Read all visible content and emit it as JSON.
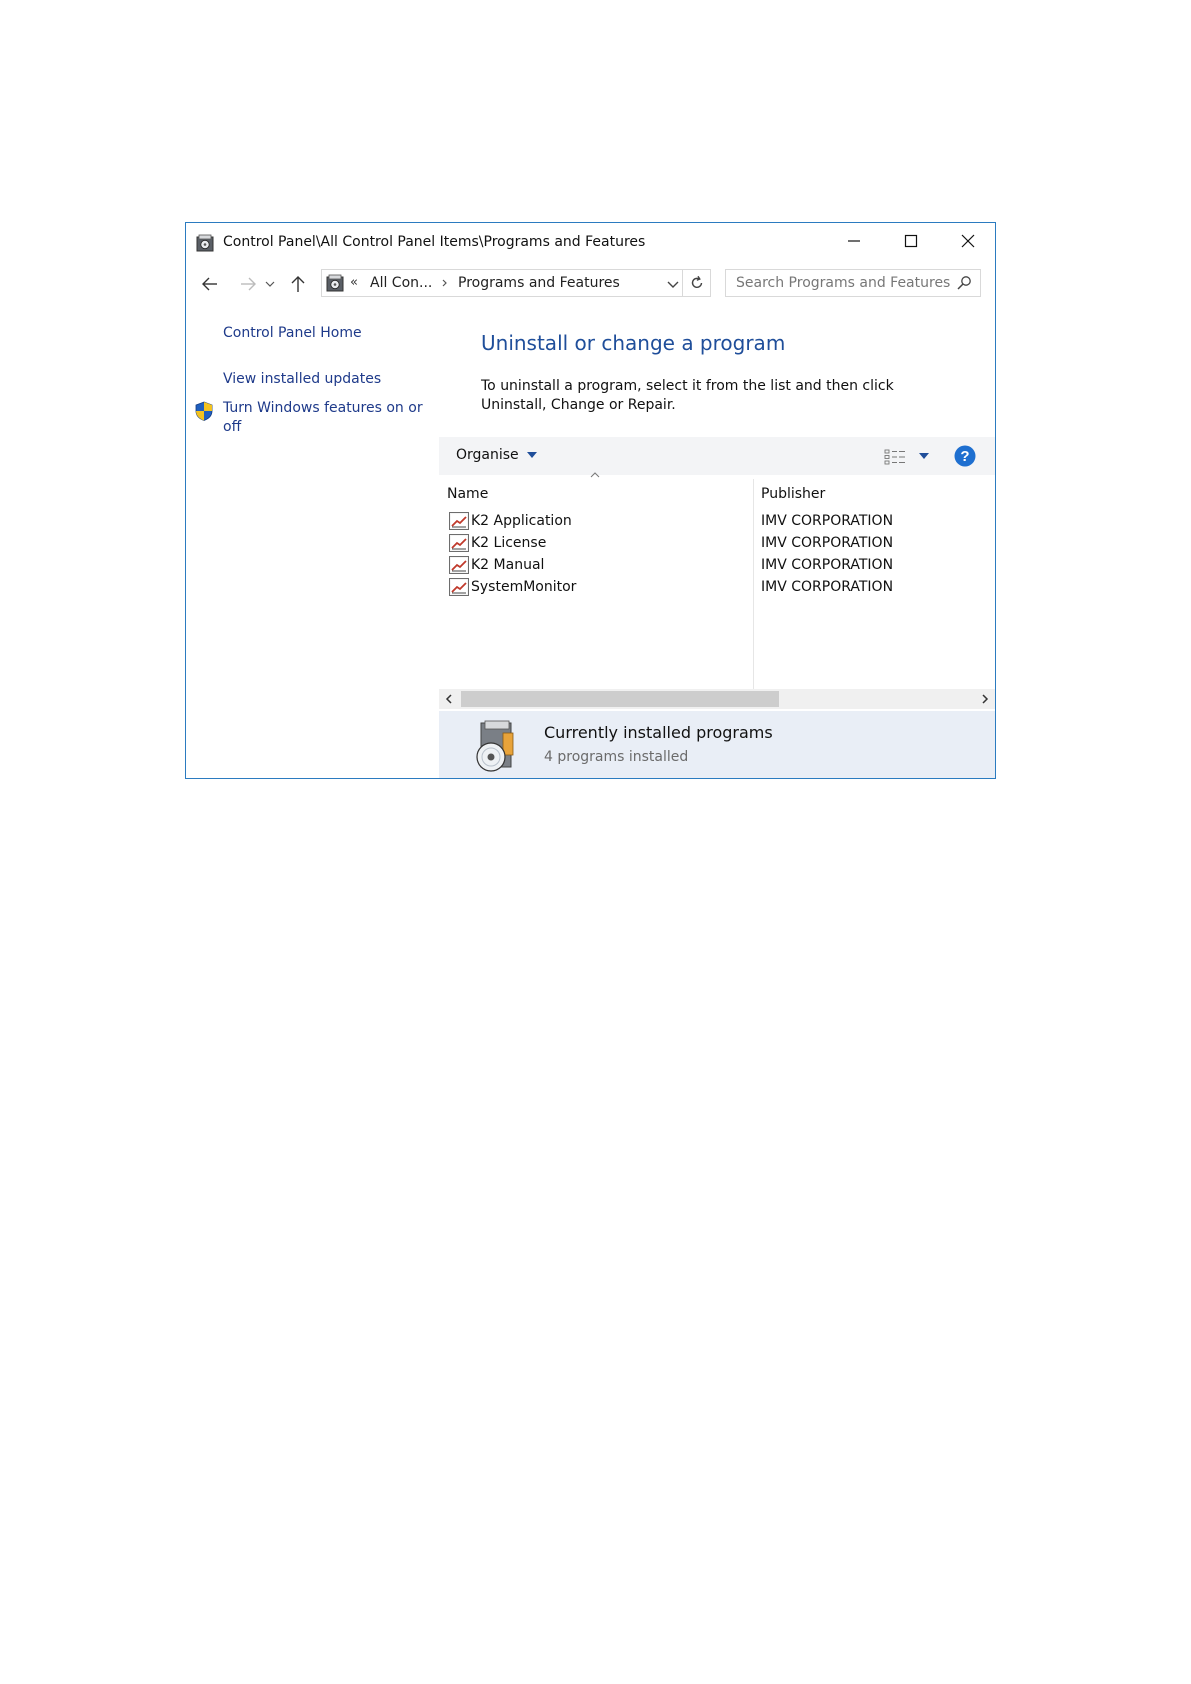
{
  "window": {
    "title": "Control Panel\\All Control Panel Items\\Programs and Features"
  },
  "address": {
    "chevrons": "«",
    "crumbs": [
      "All Con...",
      "Programs and Features"
    ]
  },
  "search": {
    "placeholder": "Search Programs and Features"
  },
  "left_pane": {
    "home": "Control Panel Home",
    "updates": "View installed updates",
    "features": "Turn Windows features on or off"
  },
  "main": {
    "heading": "Uninstall or change a program",
    "description": "To uninstall a program, select it from the list and then click Uninstall, Change or Repair."
  },
  "toolbar": {
    "organise": "Organise",
    "help": "?"
  },
  "list": {
    "columns": [
      "Name",
      "Publisher"
    ],
    "rows": [
      {
        "name": "K2 Application",
        "publisher": "IMV CORPORATION"
      },
      {
        "name": "K2 License",
        "publisher": "IMV CORPORATION"
      },
      {
        "name": "K2 Manual",
        "publisher": "IMV CORPORATION"
      },
      {
        "name": "SystemMonitor",
        "publisher": "IMV CORPORATION"
      }
    ]
  },
  "details": {
    "title": "Currently installed programs",
    "count": "4 programs installed"
  },
  "icons": {
    "window": "control-panel-icon",
    "shield": "uac-shield-icon",
    "program": "program-icon",
    "help": "help-icon"
  },
  "colors": {
    "window_border": "#2b7bc0",
    "link": "#1e3a8a",
    "heading": "#1f4e9a",
    "help_badge": "#1e6fd0",
    "details_bg": "#e9eef6"
  }
}
